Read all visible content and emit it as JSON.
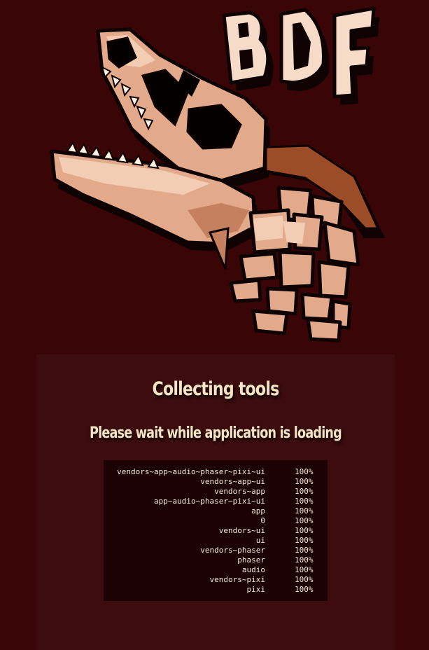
{
  "logo": {
    "text": "BDF",
    "icon": "dragon-skull-logo",
    "colors": {
      "bone": "#e2a98a",
      "bone_light": "#f3cdb3",
      "bone_shade": "#c4805f",
      "outline": "#0e0203",
      "horn": "#9c4c26",
      "letters": "#f6dbc8"
    }
  },
  "loader": {
    "title": "Collecting tools",
    "subtitle": "Please wait while application is loading",
    "modules": [
      {
        "name": "vendors~app~audio~phaser~pixi~ui",
        "progress": "100%"
      },
      {
        "name": "vendors~app~ui",
        "progress": "100%"
      },
      {
        "name": "vendors~app",
        "progress": "100%"
      },
      {
        "name": "app~audio~phaser~pixi~ui",
        "progress": "100%"
      },
      {
        "name": "app",
        "progress": "100%"
      },
      {
        "name": "0",
        "progress": "100%"
      },
      {
        "name": "vendors~ui",
        "progress": "100%"
      },
      {
        "name": "ui",
        "progress": "100%"
      },
      {
        "name": "vendors~phaser",
        "progress": "100%"
      },
      {
        "name": "phaser",
        "progress": "100%"
      },
      {
        "name": "audio",
        "progress": "100%"
      },
      {
        "name": "vendors~pixi",
        "progress": "100%"
      },
      {
        "name": "pixi",
        "progress": "100%"
      }
    ]
  },
  "colors": {
    "page_background": "#3a0506",
    "panel_background": "#3c0c0e",
    "progress_background": "#1c0203",
    "heading_text": "#f5e3c3",
    "progress_text": "#f2eadb"
  }
}
